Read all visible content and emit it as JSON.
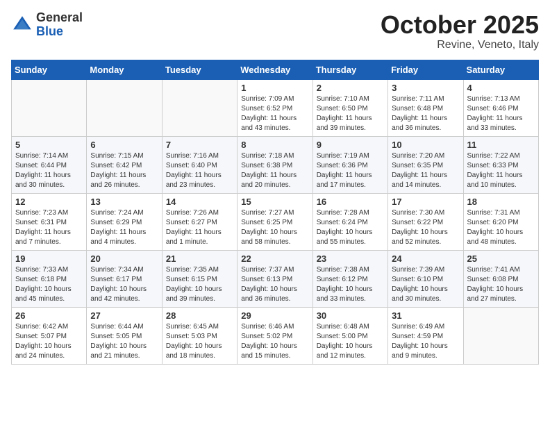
{
  "header": {
    "logo_general": "General",
    "logo_blue": "Blue",
    "month": "October 2025",
    "location": "Revine, Veneto, Italy"
  },
  "days_of_week": [
    "Sunday",
    "Monday",
    "Tuesday",
    "Wednesday",
    "Thursday",
    "Friday",
    "Saturday"
  ],
  "weeks": [
    [
      {
        "day": "",
        "info": ""
      },
      {
        "day": "",
        "info": ""
      },
      {
        "day": "",
        "info": ""
      },
      {
        "day": "1",
        "info": "Sunrise: 7:09 AM\nSunset: 6:52 PM\nDaylight: 11 hours\nand 43 minutes."
      },
      {
        "day": "2",
        "info": "Sunrise: 7:10 AM\nSunset: 6:50 PM\nDaylight: 11 hours\nand 39 minutes."
      },
      {
        "day": "3",
        "info": "Sunrise: 7:11 AM\nSunset: 6:48 PM\nDaylight: 11 hours\nand 36 minutes."
      },
      {
        "day": "4",
        "info": "Sunrise: 7:13 AM\nSunset: 6:46 PM\nDaylight: 11 hours\nand 33 minutes."
      }
    ],
    [
      {
        "day": "5",
        "info": "Sunrise: 7:14 AM\nSunset: 6:44 PM\nDaylight: 11 hours\nand 30 minutes."
      },
      {
        "day": "6",
        "info": "Sunrise: 7:15 AM\nSunset: 6:42 PM\nDaylight: 11 hours\nand 26 minutes."
      },
      {
        "day": "7",
        "info": "Sunrise: 7:16 AM\nSunset: 6:40 PM\nDaylight: 11 hours\nand 23 minutes."
      },
      {
        "day": "8",
        "info": "Sunrise: 7:18 AM\nSunset: 6:38 PM\nDaylight: 11 hours\nand 20 minutes."
      },
      {
        "day": "9",
        "info": "Sunrise: 7:19 AM\nSunset: 6:36 PM\nDaylight: 11 hours\nand 17 minutes."
      },
      {
        "day": "10",
        "info": "Sunrise: 7:20 AM\nSunset: 6:35 PM\nDaylight: 11 hours\nand 14 minutes."
      },
      {
        "day": "11",
        "info": "Sunrise: 7:22 AM\nSunset: 6:33 PM\nDaylight: 11 hours\nand 10 minutes."
      }
    ],
    [
      {
        "day": "12",
        "info": "Sunrise: 7:23 AM\nSunset: 6:31 PM\nDaylight: 11 hours\nand 7 minutes."
      },
      {
        "day": "13",
        "info": "Sunrise: 7:24 AM\nSunset: 6:29 PM\nDaylight: 11 hours\nand 4 minutes."
      },
      {
        "day": "14",
        "info": "Sunrise: 7:26 AM\nSunset: 6:27 PM\nDaylight: 11 hours\nand 1 minute."
      },
      {
        "day": "15",
        "info": "Sunrise: 7:27 AM\nSunset: 6:25 PM\nDaylight: 10 hours\nand 58 minutes."
      },
      {
        "day": "16",
        "info": "Sunrise: 7:28 AM\nSunset: 6:24 PM\nDaylight: 10 hours\nand 55 minutes."
      },
      {
        "day": "17",
        "info": "Sunrise: 7:30 AM\nSunset: 6:22 PM\nDaylight: 10 hours\nand 52 minutes."
      },
      {
        "day": "18",
        "info": "Sunrise: 7:31 AM\nSunset: 6:20 PM\nDaylight: 10 hours\nand 48 minutes."
      }
    ],
    [
      {
        "day": "19",
        "info": "Sunrise: 7:33 AM\nSunset: 6:18 PM\nDaylight: 10 hours\nand 45 minutes."
      },
      {
        "day": "20",
        "info": "Sunrise: 7:34 AM\nSunset: 6:17 PM\nDaylight: 10 hours\nand 42 minutes."
      },
      {
        "day": "21",
        "info": "Sunrise: 7:35 AM\nSunset: 6:15 PM\nDaylight: 10 hours\nand 39 minutes."
      },
      {
        "day": "22",
        "info": "Sunrise: 7:37 AM\nSunset: 6:13 PM\nDaylight: 10 hours\nand 36 minutes."
      },
      {
        "day": "23",
        "info": "Sunrise: 7:38 AM\nSunset: 6:12 PM\nDaylight: 10 hours\nand 33 minutes."
      },
      {
        "day": "24",
        "info": "Sunrise: 7:39 AM\nSunset: 6:10 PM\nDaylight: 10 hours\nand 30 minutes."
      },
      {
        "day": "25",
        "info": "Sunrise: 7:41 AM\nSunset: 6:08 PM\nDaylight: 10 hours\nand 27 minutes."
      }
    ],
    [
      {
        "day": "26",
        "info": "Sunrise: 6:42 AM\nSunset: 5:07 PM\nDaylight: 10 hours\nand 24 minutes."
      },
      {
        "day": "27",
        "info": "Sunrise: 6:44 AM\nSunset: 5:05 PM\nDaylight: 10 hours\nand 21 minutes."
      },
      {
        "day": "28",
        "info": "Sunrise: 6:45 AM\nSunset: 5:03 PM\nDaylight: 10 hours\nand 18 minutes."
      },
      {
        "day": "29",
        "info": "Sunrise: 6:46 AM\nSunset: 5:02 PM\nDaylight: 10 hours\nand 15 minutes."
      },
      {
        "day": "30",
        "info": "Sunrise: 6:48 AM\nSunset: 5:00 PM\nDaylight: 10 hours\nand 12 minutes."
      },
      {
        "day": "31",
        "info": "Sunrise: 6:49 AM\nSunset: 4:59 PM\nDaylight: 10 hours\nand 9 minutes."
      },
      {
        "day": "",
        "info": ""
      }
    ]
  ]
}
